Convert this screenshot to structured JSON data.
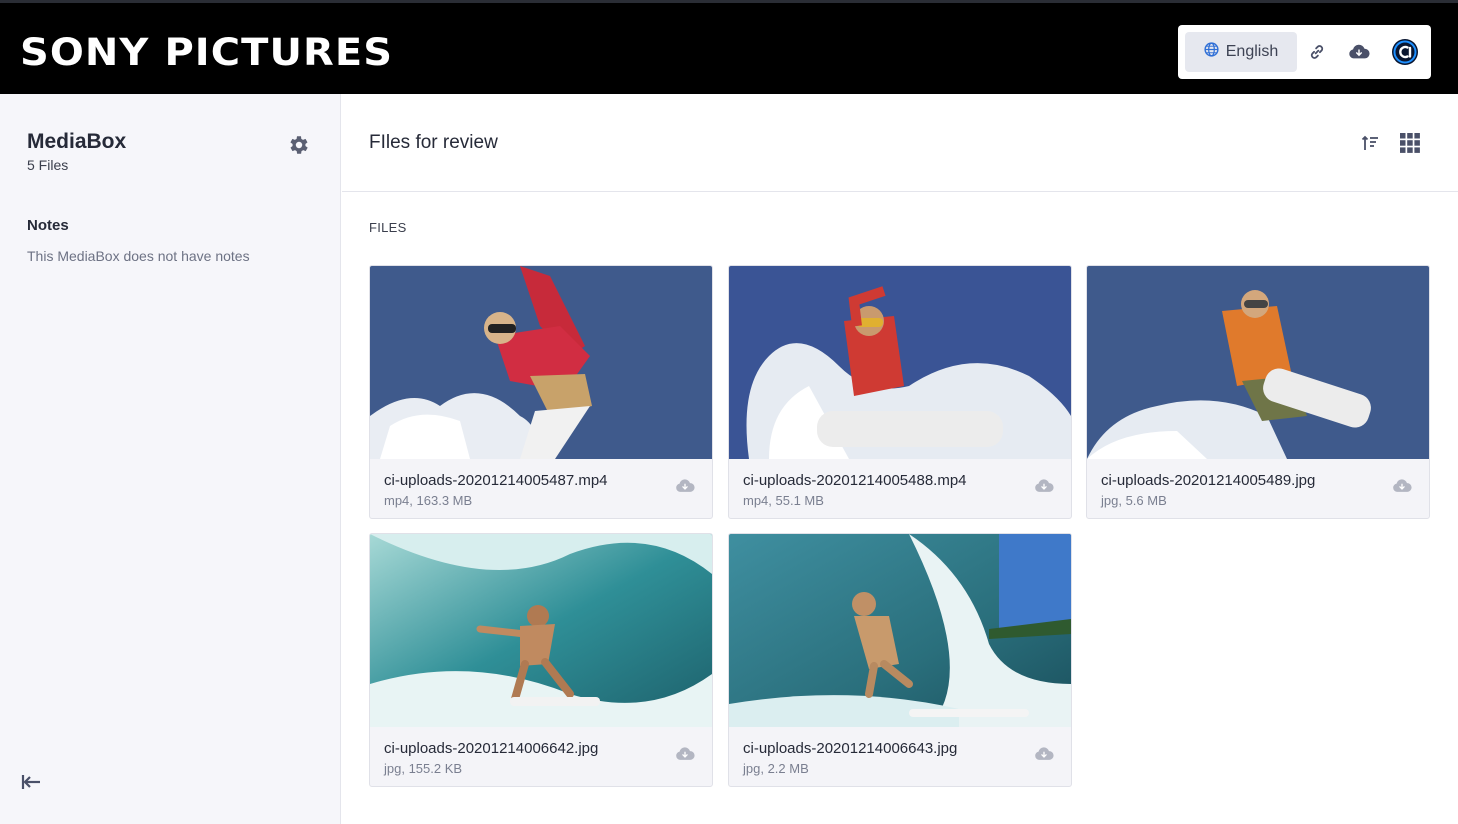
{
  "header": {
    "logo": "SONY PICTURES",
    "language_label": "English",
    "icons": [
      "globe-icon",
      "link-icon",
      "cloud-download-icon",
      "ci-logo-icon"
    ]
  },
  "sidebar": {
    "title": "MediaBox",
    "file_count": "5 Files",
    "notes_heading": "Notes",
    "notes_text": "This MediaBox does not have notes"
  },
  "main": {
    "title": "FIles for review",
    "section_label": "FILES",
    "files": [
      {
        "name": "ci-uploads-20201214005487.mp4",
        "meta": "mp4, 163.3 MB"
      },
      {
        "name": "ci-uploads-20201214005488.mp4",
        "meta": "mp4, 55.1 MB"
      },
      {
        "name": "ci-uploads-20201214005489.jpg",
        "meta": "jpg, 5.6 MB"
      },
      {
        "name": "ci-uploads-20201214006642.jpg",
        "meta": "jpg, 155.2 KB"
      },
      {
        "name": "ci-uploads-20201214006643.jpg",
        "meta": "jpg, 2.2 MB"
      }
    ]
  },
  "colors": {
    "header_bg": "#000000",
    "sidebar_bg": "#f6f6fa",
    "accent": "#0057b8",
    "sky": "#3f5a8c"
  }
}
